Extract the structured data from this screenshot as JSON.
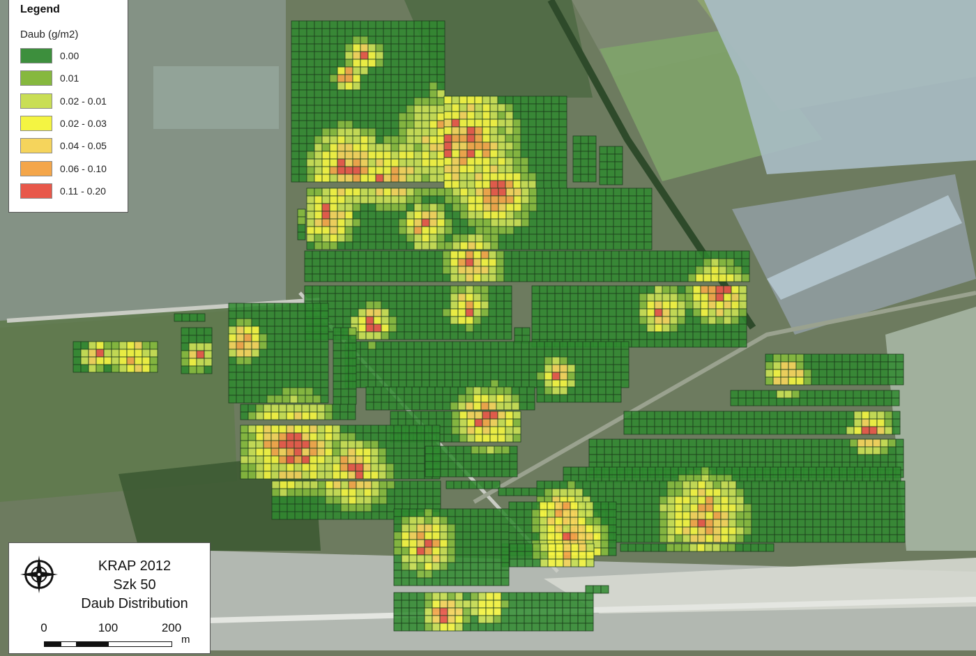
{
  "legend": {
    "title": "Legend",
    "subtitle": "Daub (g/m2)",
    "items": [
      {
        "label": "0.00",
        "color": "#3d8f3d"
      },
      {
        "label": "0.01",
        "color": "#86b83e"
      },
      {
        "label": "0.02 - 0.01",
        "color": "#c9de55"
      },
      {
        "label": "0.02 - 0.03",
        "color": "#f4f442"
      },
      {
        "label": "0.04 - 0.05",
        "color": "#f5d45c"
      },
      {
        "label": "0.06 - 0.10",
        "color": "#f4a64a"
      },
      {
        "label": "0.11 - 0.20",
        "color": "#e8584a"
      }
    ]
  },
  "title_block": {
    "line1": "KRAP 2012",
    "line2": "Szk 50",
    "line3": "Daub Distribution",
    "compass_icon": "compass-rose-icon"
  },
  "scale": {
    "labels": [
      "0",
      "100",
      "200"
    ],
    "unit": "m"
  },
  "colors": {
    "grid_base": "#2f8a2f",
    "grid_line": "#1c3d1c",
    "field_dark": "#4f6a45",
    "field_light": "#9fb4b8",
    "road": "#c9ccc4"
  }
}
